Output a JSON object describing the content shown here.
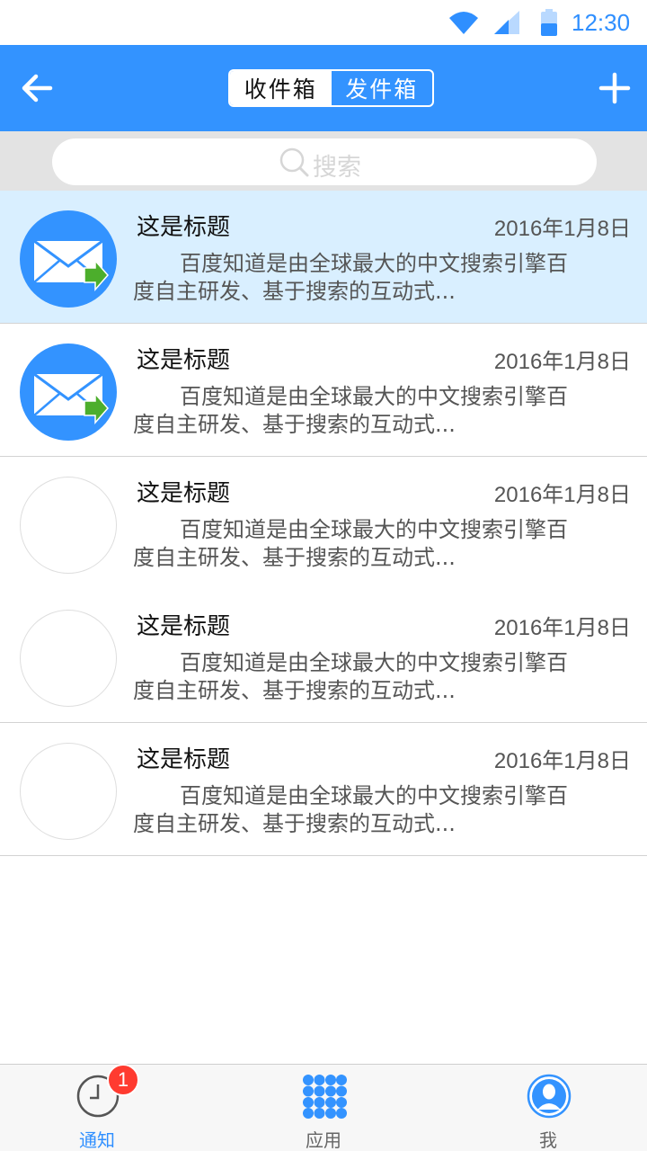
{
  "status_bar": {
    "time": "12:30",
    "icons": [
      "wifi-icon",
      "cellular-signal-icon",
      "battery-icon"
    ]
  },
  "header": {
    "back_icon": "arrow-left-icon",
    "add_icon": "plus-icon",
    "tabs": [
      {
        "label": "收件箱",
        "active": true
      },
      {
        "label": "发件箱",
        "active": false
      }
    ],
    "colors": {
      "bar": "#3393ff"
    }
  },
  "search": {
    "placeholder": "搜索",
    "icon": "search-icon"
  },
  "messages": [
    {
      "title": "这是标题",
      "date": "2016年1月8日",
      "summary": "百度知道是由全球最大的中文搜索引擎百度自主研发、基于搜索的互动式...",
      "icon": "mail-forward-icon",
      "highlighted": true
    },
    {
      "title": "这是标题",
      "date": "2016年1月8日",
      "summary": "百度知道是由全球最大的中文搜索引擎百度自主研发、基于搜索的互动式...",
      "icon": "mail-forward-icon",
      "highlighted": false
    },
    {
      "title": "这是标题",
      "date": "2016年1月8日",
      "summary": "百度知道是由全球最大的中文搜索引擎百度自主研发、基于搜索的互动式...",
      "icon": "empty-avatar",
      "highlighted": false
    },
    {
      "title": "这是标题",
      "date": "2016年1月8日",
      "summary": "百度知道是由全球最大的中文搜索引擎百度自主研发、基于搜索的互动式...",
      "icon": "empty-avatar",
      "highlighted": false
    },
    {
      "title": "这是标题",
      "date": "2016年1月8日",
      "summary": "百度知道是由全球最大的中文搜索引擎百度自主研发、基于搜索的互动式...",
      "icon": "empty-avatar",
      "highlighted": false
    }
  ],
  "bottom_nav": {
    "items": [
      {
        "label": "通知",
        "icon": "clock-icon",
        "active": true,
        "badge": "1"
      },
      {
        "label": "应用",
        "icon": "apps-grid-icon",
        "active": false
      },
      {
        "label": "我",
        "icon": "profile-icon",
        "active": false
      }
    ],
    "colors": {
      "active": "#2f8fff",
      "badge": "#ff3b30"
    }
  }
}
